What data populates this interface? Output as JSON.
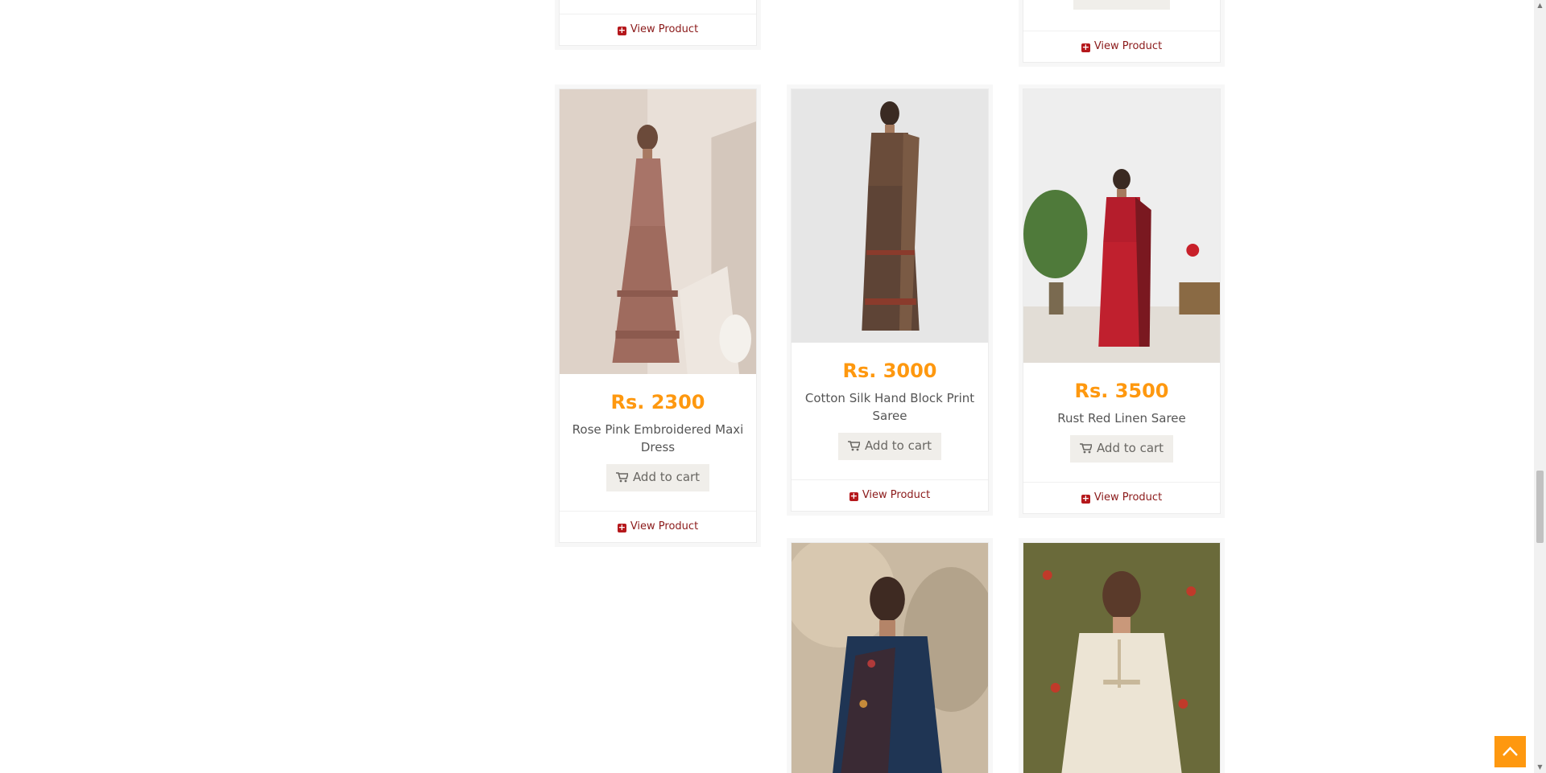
{
  "top_row": {
    "left": {
      "view_label": "View Product"
    },
    "right": {
      "view_label": "View Product"
    }
  },
  "products": [
    {
      "price": "Rs. 2300",
      "name": "Rose Pink Embroidered Maxi Dress",
      "cart_label": "Add to cart",
      "view_label": "View Product"
    },
    {
      "price": "Rs. 3000",
      "name": "Cotton Silk Hand Block Print Saree",
      "cart_label": "Add to cart",
      "view_label": "View Product"
    },
    {
      "price": "Rs. 3500",
      "name": "Rust Red Linen Saree",
      "cart_label": "Add to cart",
      "view_label": "View Product"
    }
  ],
  "icons": {
    "cart": "shopping-cart-icon",
    "view": "plus-square-icon",
    "scroll_top": "chevron-up-icon"
  },
  "colors": {
    "price": "#fe980f",
    "link": "#8b1a1a",
    "accent": "#fe980f"
  }
}
